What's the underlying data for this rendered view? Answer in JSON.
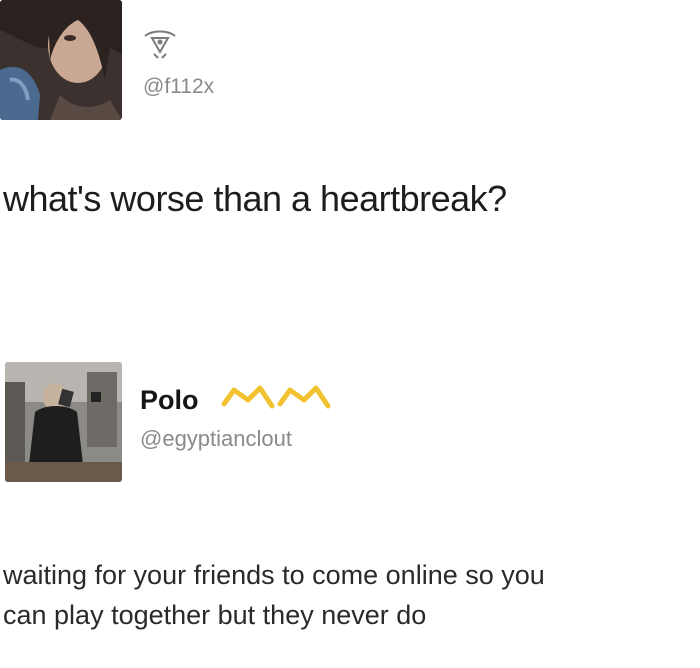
{
  "first_tweet": {
    "handle": "@f112x",
    "text": "what's worse than a heartbreak?",
    "name_icon": "tri-symbol-icon"
  },
  "second_tweet": {
    "display_name": "Polo",
    "handle": "@egyptianclout",
    "emoji_icon": "crown-emoji-icon",
    "line1": "waiting for your friends to come online so you",
    "line2": "can play together but they never do"
  },
  "colors": {
    "handle": "#8a8a8a",
    "crown": "#f2c230",
    "text": "#1d1d1d"
  }
}
